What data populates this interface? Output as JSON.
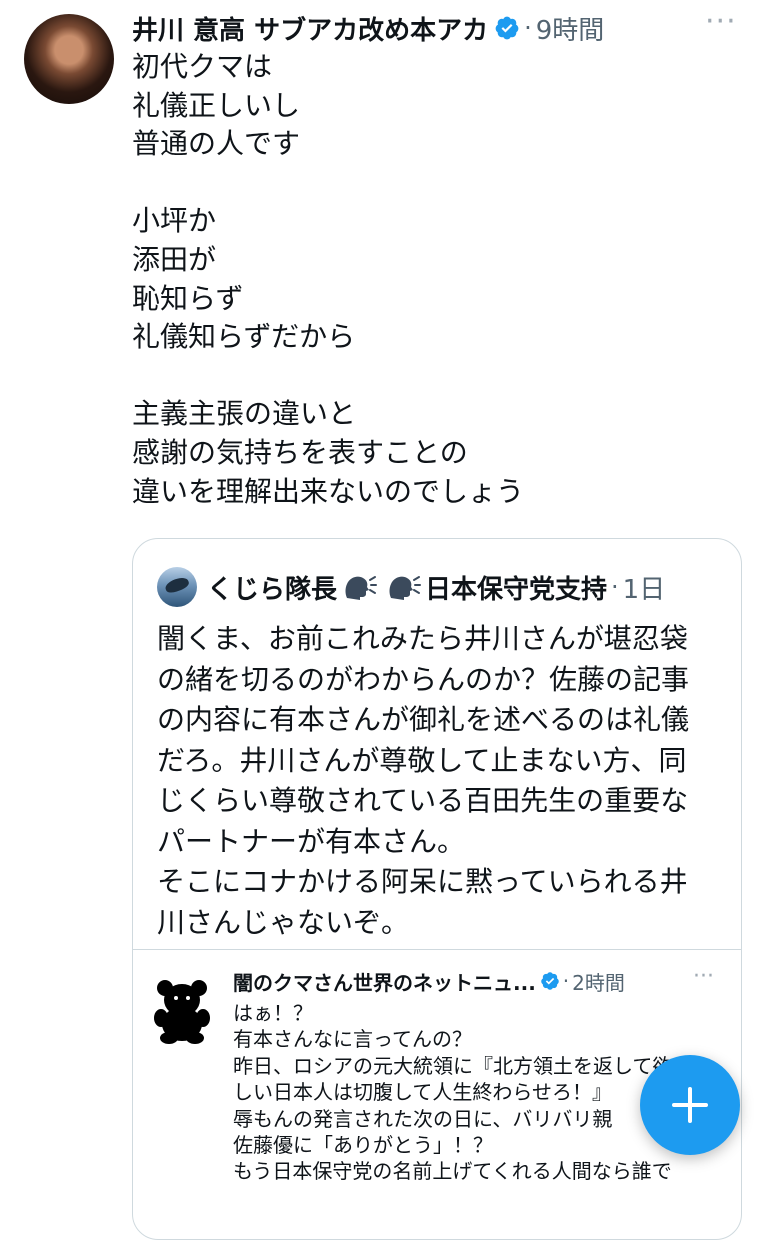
{
  "tweet": {
    "author_name": "井川 意高 サブアカ改め本アカ",
    "time": "9時間",
    "more_icon": "···",
    "body_lines": [
      "初代クマは",
      "礼儀正しいし",
      "普通の人です",
      "",
      "小坪か",
      "添田が",
      "恥知らず",
      "礼儀知らずだから",
      "",
      "主義主張の違いと",
      "感謝の気持ちを表すことの",
      "違いを理解出来ないのでしょう"
    ]
  },
  "quote": {
    "author_name": "くじら隊長",
    "author_suffix": "日本保守党支持",
    "time": "1日",
    "body_lines": [
      "闇くま、お前これみたら井川さんが堪忍袋",
      "の緒を切るのがわからんのか？佐藤の記事",
      "の内容に有本さんが御礼を述べるのは礼儀",
      "だろ。井川さんが尊敬して止まない方、同",
      "じくらい尊敬されている百田先生の重要な",
      "パートナーが有本さん。",
      "そこにコナかける阿呆に黙っていられる井",
      "川さんじゃないぞ。"
    ]
  },
  "inner_quote": {
    "author_name": "闇のクマさん世界のネットニュ...",
    "time": "2時間",
    "more_icon": "···",
    "body_lines": [
      "はぁ！？",
      "有本さんなに言ってんの？",
      "昨日、ロシアの元大統領に『北方領土を返して欲",
      "しい日本人は切腹して人生終わらせろ！』",
      "辱もんの発言された次の日に、バリバリ親",
      "佐藤優に「ありがとう」！？",
      "もう日本保守党の名前上げてくれる人間なら誰で"
    ]
  },
  "fab": {
    "label": "+"
  },
  "colors": {
    "accent": "#1d9bf0",
    "text": "#0f1419",
    "muted": "#536471",
    "border": "#cfd9de"
  }
}
